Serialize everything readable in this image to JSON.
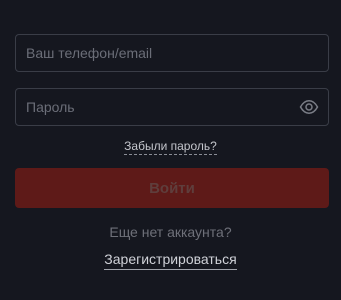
{
  "form": {
    "login_placeholder": "Ваш телефон/email",
    "login_value": "",
    "password_placeholder": "Пароль",
    "password_value": "",
    "password_toggle_icon": "eye-icon",
    "forgot_password": "Забыли пароль?",
    "submit_label": "Войти",
    "no_account_text": "Еще нет аккаунта?",
    "register_link": "Зарегистрироваться"
  },
  "colors": {
    "background": "#15171f",
    "input_border": "#3a3d47",
    "submit_background": "#5e1a18",
    "submit_text": "#5f3e3c"
  }
}
